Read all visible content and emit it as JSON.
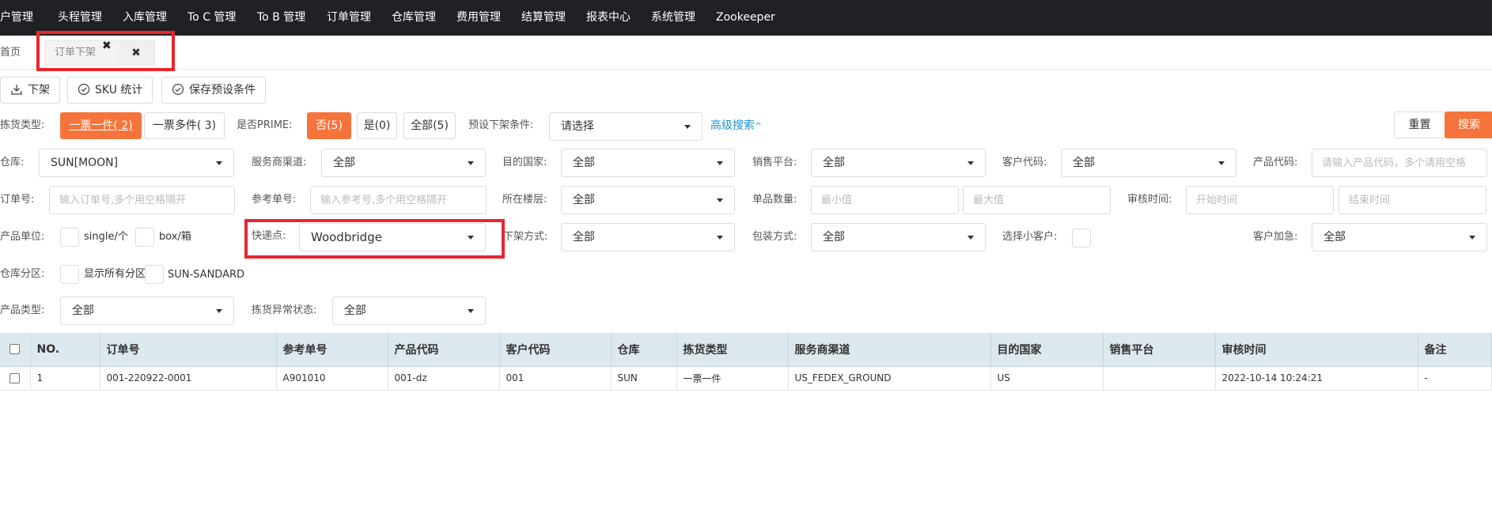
{
  "nav": {
    "items": [
      "客户管理",
      "头程管理",
      "入库管理",
      "To C 管理",
      "To B 管理",
      "订单管理",
      "仓库管理",
      "费用管理",
      "结算管理",
      "报表中心",
      "系统管理",
      "Zookeeper"
    ]
  },
  "tabs": {
    "home": "首页",
    "active": "订单下架",
    "x_mark": "✖",
    "close": "✖"
  },
  "toolbar": {
    "offshelf": "下架",
    "sku_stats": "SKU 统计",
    "save_preset": "保存预设条件"
  },
  "filters": {
    "pick_type_label": "拣货类型:",
    "pick_single": "一票一件( 2)",
    "pick_multi": "一票多件( 3)",
    "prime_label": "是否PRIME:",
    "prime_no": "否(5)",
    "prime_yes": "是(0)",
    "prime_all": "全部(5)",
    "preset_label": "预设下架条件:",
    "preset_value": "请选择",
    "advanced": "高级搜索",
    "advanced_icon": "^",
    "reset": "重置",
    "search": "搜索",
    "warehouse_label": "仓库:",
    "warehouse_value": "SUN[MOON]",
    "channel_label": "服务商渠道:",
    "channel_value": "全部",
    "dest_label": "目的国家:",
    "dest_value": "全部",
    "platform_label": "销售平台:",
    "platform_value": "全部",
    "customer_label": "客户代码:",
    "customer_value": "全部",
    "product_label": "产品代码:",
    "product_placeholder": "请输入产品代码，多个请用空格",
    "order_label": "订单号:",
    "order_placeholder": "输入订单号,多个用空格隔开",
    "ref_label": "参考单号:",
    "ref_placeholder": "输入参考号,多个用空格隔开",
    "floor_label": "所在楼层:",
    "floor_value": "全部",
    "qty_label": "单品数量:",
    "qty_min": "最小值",
    "qty_max": "最大值",
    "review_label": "审核时间:",
    "review_start": "开始时间",
    "review_end": "结束时间",
    "unit_label": "产品单位:",
    "unit_single": "single/个",
    "unit_box": "box/箱",
    "express_label": "快递点:",
    "express_value": "Woodbridge",
    "offshelf_mode_label": "下架方式:",
    "offshelf_mode_value": "全部",
    "pack_label": "包装方式:",
    "pack_value": "全部",
    "small_customer_label": "选择小客户:",
    "urgent_label": "客户加急:",
    "urgent_value": "全部",
    "zone_label": "仓库分区:",
    "zone_all": "显示所有分区",
    "zone_sun": "SUN-SANDARD",
    "ptype_label": "产品类型:",
    "ptype_value": "全部",
    "abnormal_label": "拣货异常状态:",
    "abnormal_value": "全部"
  },
  "table": {
    "headers": [
      "NO.",
      "订单号",
      "参考单号",
      "产品代码",
      "客户代码",
      "仓库",
      "拣货类型",
      "服务商渠道",
      "目的国家",
      "销售平台",
      "审核时间",
      "备注"
    ],
    "rows": [
      [
        "1",
        "001-220922-0001",
        "A901010",
        "001-dz",
        "001",
        "SUN",
        "一票一件",
        "US_FEDEX_GROUND",
        "US",
        "",
        "2022-10-14 10:24:21",
        "-"
      ]
    ]
  },
  "colors": {
    "nav_bg": "#1f2125",
    "accent": "#f5743b",
    "highlight_box": "#e8262e",
    "link": "#1e90d5",
    "table_header_bg": "#dde8ef"
  }
}
